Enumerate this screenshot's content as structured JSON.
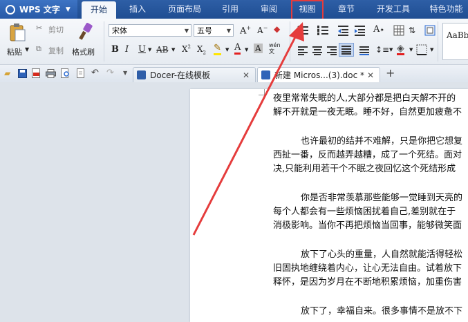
{
  "app": {
    "name": "WPS 文字"
  },
  "menu": {
    "tabs": [
      "开始",
      "插入",
      "页面布局",
      "引用",
      "审阅",
      "视图",
      "章节",
      "开发工具",
      "特色功能"
    ]
  },
  "ribbon": {
    "paste": "粘贴",
    "cut": "剪切",
    "copy": "复制",
    "format_painter": "格式刷",
    "font_name": "宋体",
    "font_size": "五号",
    "style_preview": "AaBb"
  },
  "tabs": [
    {
      "label": "Docer-在线模板"
    },
    {
      "label": "新建 Micros...(3).doc *"
    }
  ],
  "document": {
    "paragraphs": [
      {
        "lines": [
          "夜里常常失眠的人,大部分都是把白天解不开的",
          "解不开就是一夜无眠。睡不好，自然更加疲惫不"
        ]
      },
      {
        "lines": [
          "也许最初的结并不难解，只是你把它想复",
          "西扯一番，反而越弄越糟，成了一个死结。面对",
          "决,只能利用若干个不眠之夜回忆这个死结形成"
        ]
      },
      {
        "lines": [
          "你是否非常羡慕那些能够一觉睡到天亮的",
          "每个人都会有一些烦恼困扰着自己,差别就在于",
          "消极影响。当你不再把烦恼当回事，能够微笑面"
        ]
      },
      {
        "lines": [
          "放下了心头的重量，人自然就能活得轻松",
          "旧固执地缠绕着内心，让心无法自由。试着放下",
          "释怀，是因为岁月在不断地积累烦恼，加重伤害"
        ]
      },
      {
        "lines": [
          "放下了，幸福自来。很多事情不是放不下"
        ]
      }
    ]
  },
  "colors": {
    "menubar": "#1f4d92",
    "highlight": "#e53c3c",
    "arrow": "#e53c3c"
  }
}
